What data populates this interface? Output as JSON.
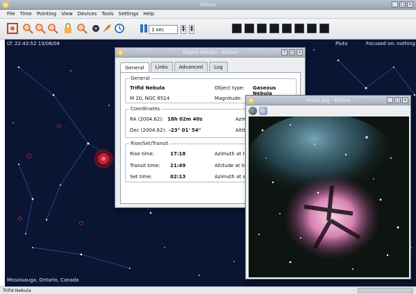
{
  "app": {
    "title": "KStars"
  },
  "menu": [
    "File",
    "Time",
    "Pointing",
    "View",
    "Devices",
    "Tools",
    "Settings",
    "Help"
  ],
  "toolbar": {
    "time_step": "1 sec"
  },
  "sky": {
    "clock": "LT: 22:43:52  13/08/04",
    "planet_label": "Pluto",
    "focus": "Focused on: nothing",
    "location": "Mississauga, Ontario, Canada"
  },
  "status": {
    "text": "Trifid Nebula"
  },
  "details": {
    "title": "Object Details - KStars",
    "tabs": [
      "General",
      "Links",
      "Advanced",
      "Log"
    ],
    "active_tab": "General",
    "general": {
      "label": "General",
      "name": "Trifid Nebula",
      "alt_names": "M 20, NGC 6514",
      "type_label": "Object type:",
      "type_value": "Gaseous Nebula",
      "mag_label": "Magnitude:"
    },
    "coords": {
      "label": "Coordinates",
      "ra_label": "RA (2004.62):",
      "ra_value": "18h 02m 40s",
      "dec_label": "Dec (2004.62):",
      "dec_value": "-23° 01' 54\"",
      "az_label": "Azimu",
      "alt_label": "Altitu"
    },
    "rst": {
      "label": "Rise/Set/Transit",
      "rise_label": "Rise time:",
      "rise_value": "17:18",
      "transit_label": "Transit time:",
      "transit_value": "21:49",
      "set_label": "Set time:",
      "set_value": "02:13",
      "az_rise": "Azimuth at ri",
      "alt_transit": "Altitude at tr",
      "az_set": "Azimuth at s"
    }
  },
  "image_window": {
    "title": "m20u.jpg - KStars"
  }
}
